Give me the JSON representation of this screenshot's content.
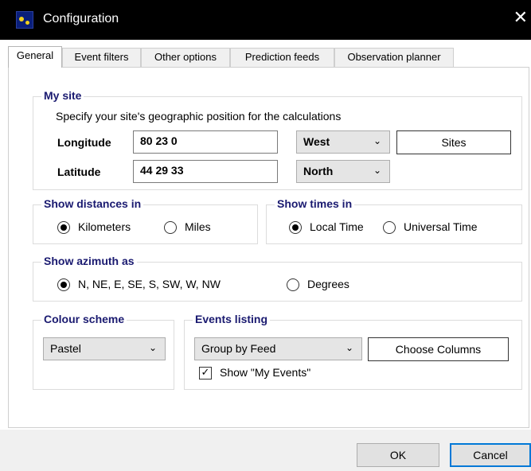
{
  "window": {
    "title": "Configuration",
    "close_glyph": "✕"
  },
  "tabs": [
    {
      "label": "General",
      "active": true
    },
    {
      "label": "Event filters"
    },
    {
      "label": "Other options"
    },
    {
      "label": "Prediction feeds"
    },
    {
      "label": "Observation planner"
    }
  ],
  "my_site": {
    "legend": "My site",
    "description": "Specify your site's geographic position for the calculations",
    "longitude_label": "Longitude",
    "longitude_value": "80 23  0",
    "longitude_dir": "West",
    "latitude_label": "Latitude",
    "latitude_value": "44 29 33",
    "latitude_dir": "North",
    "sites_button": "Sites"
  },
  "distances": {
    "legend": "Show distances in",
    "options": [
      "Kilometers",
      "Miles"
    ],
    "selected": "Kilometers"
  },
  "times": {
    "legend": "Show times in",
    "options": [
      "Local Time",
      "Universal Time"
    ],
    "selected": "Local Time"
  },
  "azimuth": {
    "legend": "Show azimuth as",
    "options": [
      "N, NE, E, SE, S, SW, W, NW",
      "Degrees"
    ],
    "selected": "N, NE, E, SE, S, SW, W, NW"
  },
  "colour_scheme": {
    "legend": "Colour scheme",
    "value": "Pastel"
  },
  "events_listing": {
    "legend": "Events listing",
    "value": "Group by Feed",
    "choose_columns_button": "Choose Columns",
    "show_my_events_label": "Show \"My Events\"",
    "show_my_events_checked": true,
    "check_glyph": "✓"
  },
  "dialog_buttons": {
    "ok": "OK",
    "cancel": "Cancel"
  },
  "icons": {
    "chevron": "⌄",
    "app_icon": "satellite-app-icon"
  },
  "colors": {
    "title_bar": "#000000",
    "legend_text": "#1a1a70",
    "default_button_border": "#0078d7"
  }
}
